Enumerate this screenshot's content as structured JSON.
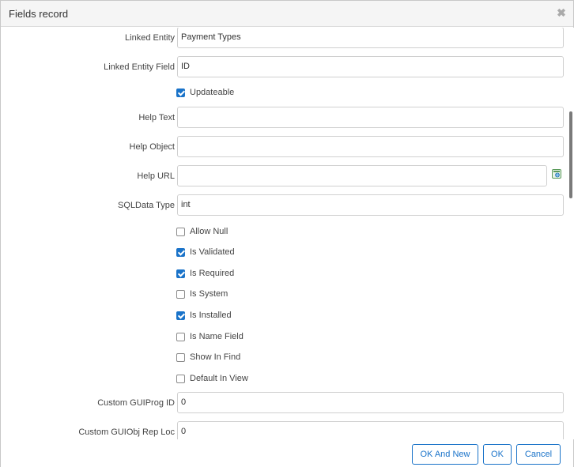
{
  "dialog": {
    "title": "Fields record",
    "close_glyph": "✖"
  },
  "fields": {
    "linked_entity": {
      "label": "Linked Entity",
      "value": "Payment Types"
    },
    "linked_entity_field": {
      "label": "Linked Entity Field",
      "value": "ID"
    },
    "updateable": {
      "label": "Updateable",
      "checked": true
    },
    "help_text": {
      "label": "Help Text",
      "value": ""
    },
    "help_object": {
      "label": "Help Object",
      "value": ""
    },
    "help_url": {
      "label": "Help URL",
      "value": ""
    },
    "sqldata_type": {
      "label": "SQLData Type",
      "value": "int"
    },
    "checkboxes": [
      {
        "label": "Allow Null",
        "checked": false
      },
      {
        "label": "Is Validated",
        "checked": true
      },
      {
        "label": "Is Required",
        "checked": true
      },
      {
        "label": "Is System",
        "checked": false
      },
      {
        "label": "Is Installed",
        "checked": true
      },
      {
        "label": "Is Name Field",
        "checked": false
      },
      {
        "label": "Show In Find",
        "checked": false
      },
      {
        "label": "Default In View",
        "checked": false
      }
    ],
    "custom_guiprog_id": {
      "label": "Custom GUIProg ID",
      "value": "0"
    },
    "custom_guiobj_rep_loc": {
      "label": "Custom GUIObj Rep Loc",
      "value": "0"
    }
  },
  "icons": {
    "url_open": "open-url-icon"
  },
  "buttons": {
    "ok_and_new": "OK And New",
    "ok": "OK",
    "cancel": "Cancel"
  },
  "colors": {
    "accent": "#1a73c9",
    "checked_box": "#1a73c9"
  }
}
